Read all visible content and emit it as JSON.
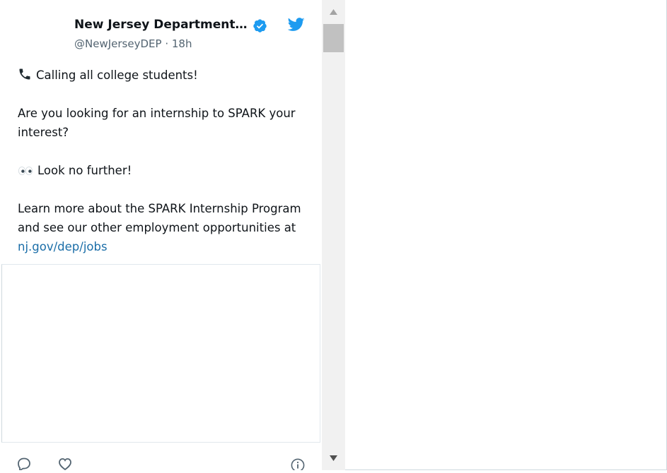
{
  "tweet": {
    "account_name": "New Jersey Department…",
    "handle": "@NewJerseyDEP",
    "separator": "·",
    "time": "18h",
    "paragraphs": [
      "Calling all college students!",
      "Are you looking for an internship to SPARK your interest?",
      "Look no further!",
      "Learn more about the SPARK Internship Program and see our other employment opportunities at"
    ],
    "link_text": "nj.gov/dep/jobs",
    "icons": {
      "verified": "verified-badge-icon",
      "brand": "twitter-bird-icon",
      "phone": "telephone-receiver-icon",
      "eyes": "eyes-icon"
    }
  },
  "actions": {
    "reply_icon": "reply-icon",
    "like_icon": "heart-icon",
    "info_icon": "info-icon"
  },
  "colors": {
    "brand_blue": "#1d9bf0",
    "link": "#1b6ea8",
    "text": "#0f1419",
    "muted": "#536471"
  }
}
